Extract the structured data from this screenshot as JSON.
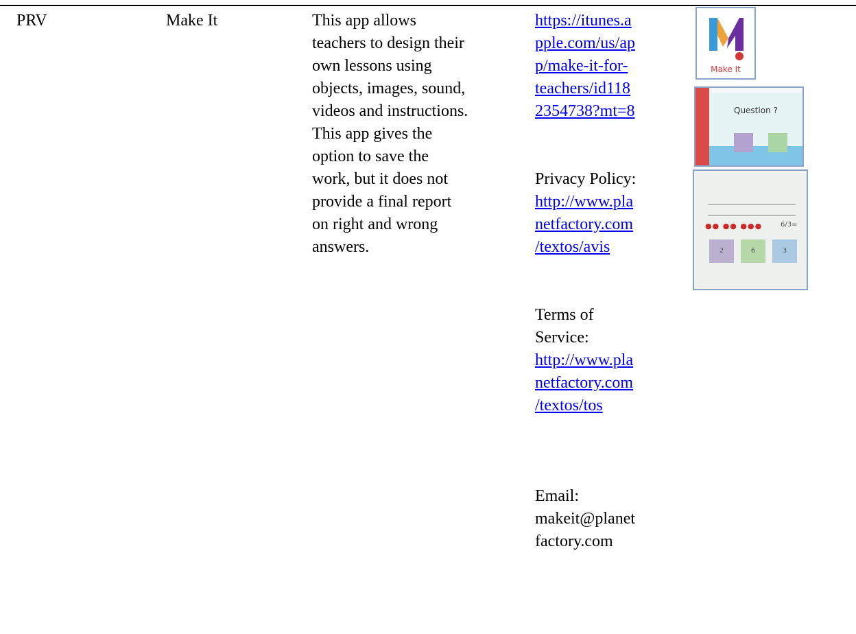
{
  "row": {
    "code": "PRV",
    "app_name": "Make It",
    "description_lines": [
      "This app allows",
      "teachers to design their",
      "own lessons using",
      "objects, images, sound,",
      "videos and instructions.",
      "This app gives the",
      "option to save the",
      "work, but it does not",
      "provide a final report",
      "on right and wrong",
      "answers."
    ],
    "store_link_lines": [
      "https://itunes.a",
      "pple.com/us/ap",
      "p/make-it-for-",
      "teachers/id118",
      "2354738?mt=8"
    ],
    "privacy_label": "Privacy Policy:",
    "privacy_link_lines": [
      "http://www.pla",
      "netfactory.com",
      "/textos/avis"
    ],
    "tos_label_lines": [
      "Terms of",
      "Service:"
    ],
    "tos_link_lines": [
      "http://www.pla",
      "netfactory.com",
      "/textos/tos"
    ],
    "email_lines": [
      "Email:",
      "makeit@planet",
      "factory.com"
    ]
  },
  "images": {
    "logo_caption": "Make It",
    "question_text": "Question ?",
    "math_equation": "6/3=",
    "math_answers": [
      "2",
      "6",
      "3"
    ]
  },
  "colors": {
    "link": "#0000ee",
    "logo_red": "#d23a3a",
    "logo_orange": "#f0a23a",
    "logo_purple": "#6a2ea0"
  }
}
